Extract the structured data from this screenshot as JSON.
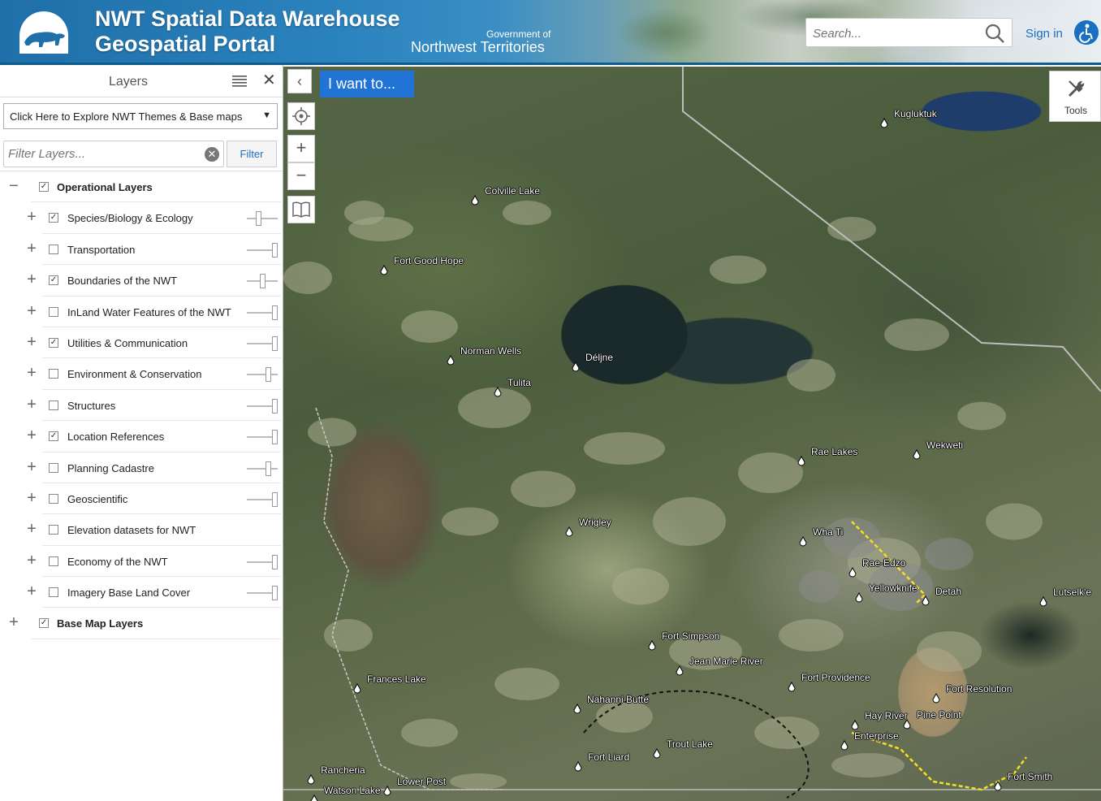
{
  "header": {
    "title_line1": "NWT Spatial Data Warehouse",
    "title_line2": "Geospatial Portal",
    "gov_line1": "Government of",
    "gov_line2": "Northwest Territories",
    "search_placeholder": "Search...",
    "sign_in": "Sign in"
  },
  "sidebar": {
    "title": "Layers",
    "theme_select": "Click Here to Explore NWT Themes & Base maps",
    "filter_placeholder": "Filter Layers...",
    "filter_button": "Filter",
    "groups": [
      {
        "label": "Operational Layers",
        "checked": true,
        "expander": "−"
      },
      {
        "label": "Base Map Layers",
        "checked": true,
        "expander": "+"
      }
    ],
    "layers": [
      {
        "label": "Species/Biology & Ecology",
        "checked": true,
        "opacity": 0.35
      },
      {
        "label": "Transportation",
        "checked": false,
        "opacity": 1
      },
      {
        "label": "Boundaries of the NWT",
        "checked": true,
        "opacity": 0.5
      },
      {
        "label": "InLand Water Features of the NWT",
        "checked": false,
        "opacity": 1
      },
      {
        "label": "Utilities & Communication",
        "checked": true,
        "opacity": 1
      },
      {
        "label": "Environment & Conservation",
        "checked": false,
        "opacity": 0.75
      },
      {
        "label": "Structures",
        "checked": false,
        "opacity": 1
      },
      {
        "label": "Location References",
        "checked": true,
        "opacity": 1
      },
      {
        "label": "Planning Cadastre",
        "checked": false,
        "opacity": 0.75
      },
      {
        "label": "Geoscientific",
        "checked": false,
        "opacity": 1
      },
      {
        "label": "Elevation datasets for NWT",
        "checked": false,
        "opacity": null
      },
      {
        "label": "Economy of the NWT",
        "checked": false,
        "opacity": 1
      },
      {
        "label": "Imagery Base Land Cover",
        "checked": false,
        "opacity": 1
      }
    ]
  },
  "map": {
    "i_want_to": "I want to...",
    "tools_label": "Tools",
    "places": [
      "Kugluktuk",
      "Colville Lake",
      "Fort Good Hope",
      "Norman Wells",
      "Déljne",
      "Tulita",
      "Rae Lakes",
      "Wekweti",
      "Wrigley",
      "Wha Ti",
      "Rae-Edzo",
      "Yellowknife",
      "Detah",
      "Lutselk'e",
      "Fort Simpson",
      "Jean Marie River",
      "Fort Providence",
      "Frances Lake",
      "Fort Resolution",
      "Nahanni Butte",
      "Hay River",
      "Pine Point",
      "Enterprise",
      "Trout Lake",
      "Fort Liard",
      "Fort Smith",
      "Rancheria",
      "Lower Post",
      "Watson Lake"
    ]
  },
  "colors": {
    "accent": "#2173d6",
    "header_blue": "#1f6fa8",
    "link": "#1a6fc2"
  }
}
